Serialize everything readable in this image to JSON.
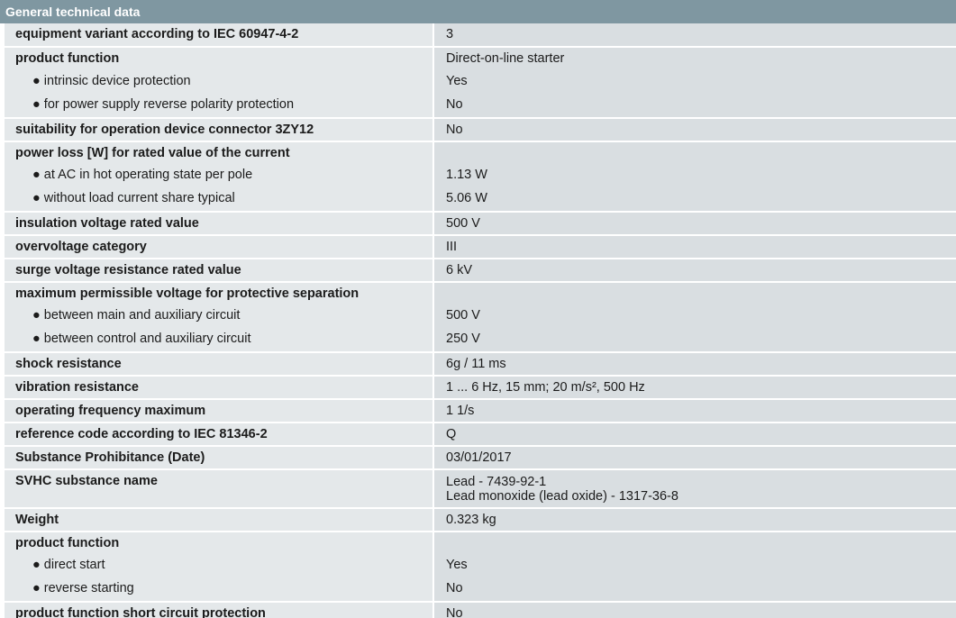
{
  "header": {
    "title": "General technical data"
  },
  "rows": [
    {
      "label": "equipment variant according to IEC 60947-4-2",
      "value": "3"
    },
    {
      "label": "product function",
      "value": "Direct-on-line starter"
    },
    {
      "label": "● intrinsic device protection",
      "value": "Yes"
    },
    {
      "label": "● for power supply reverse polarity protection",
      "value": "No"
    },
    {
      "label": "suitability for operation device connector 3ZY12",
      "value": "No"
    },
    {
      "label": "power loss [W] for rated value of the current",
      "value": ""
    },
    {
      "label": "● at AC in hot operating state per pole",
      "value": "1.13 W"
    },
    {
      "label": "● without load current share typical",
      "value": "5.06 W"
    },
    {
      "label": "insulation voltage rated value",
      "value": "500 V"
    },
    {
      "label": "overvoltage category",
      "value": "III"
    },
    {
      "label": "surge voltage resistance rated value",
      "value": "6 kV"
    },
    {
      "label": "maximum permissible voltage for protective separation",
      "value": ""
    },
    {
      "label": "● between main and auxiliary circuit",
      "value": "500 V"
    },
    {
      "label": "● between control and auxiliary circuit",
      "value": "250 V"
    },
    {
      "label": "shock resistance",
      "value": "6g / 11 ms"
    },
    {
      "label": "vibration resistance",
      "value": "1 ... 6 Hz, 15 mm; 20 m/s², 500 Hz"
    },
    {
      "label": "operating frequency maximum",
      "value": "1 1/s"
    },
    {
      "label": "reference code according to IEC 81346-2",
      "value": "Q"
    },
    {
      "label": "Substance Prohibitance (Date)",
      "value": "03/01/2017"
    },
    {
      "label": "SVHC substance name",
      "value_lines": [
        "Lead - 7439-92-1",
        "Lead monoxide (lead oxide) - 1317-36-8"
      ]
    },
    {
      "label": "Weight",
      "value": "0.323 kg"
    },
    {
      "label": "product function",
      "value": ""
    },
    {
      "label": "● direct start",
      "value": "Yes"
    },
    {
      "label": "● reverse starting",
      "value": "No"
    },
    {
      "label": "product function short circuit protection",
      "value": "No"
    }
  ]
}
